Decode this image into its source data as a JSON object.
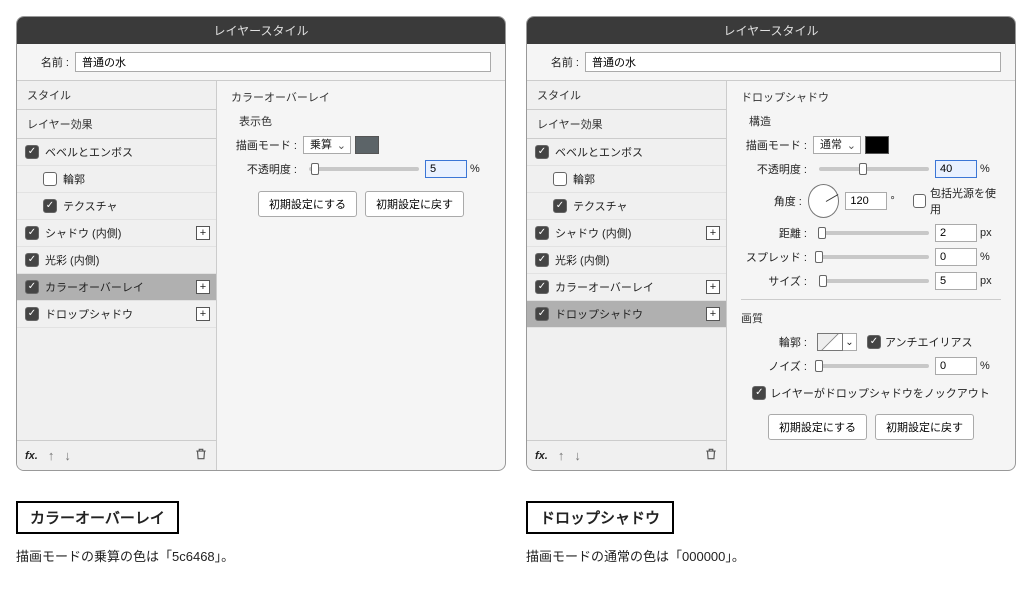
{
  "common": {
    "window_title": "レイヤースタイル",
    "name_label": "名前 :",
    "layer_name": "普通の水",
    "side": {
      "header_style": "スタイル",
      "header_effects": "レイヤー効果",
      "items": [
        {
          "label": "ベベルとエンボス",
          "checked": true,
          "plus": false,
          "child": false
        },
        {
          "label": "輪郭",
          "checked": false,
          "plus": false,
          "child": true
        },
        {
          "label": "テクスチャ",
          "checked": true,
          "plus": false,
          "child": true
        },
        {
          "label": "シャドウ (内側)",
          "checked": true,
          "plus": true,
          "child": false
        },
        {
          "label": "光彩 (内側)",
          "checked": true,
          "plus": false,
          "child": false
        },
        {
          "label": "カラーオーバーレイ",
          "checked": true,
          "plus": true,
          "child": false
        },
        {
          "label": "ドロップシャドウ",
          "checked": true,
          "plus": true,
          "child": false
        }
      ]
    },
    "buttons": {
      "default": "初期設定にする",
      "reset": "初期設定に戻す"
    }
  },
  "left": {
    "selected_index": 5,
    "group_title": "カラーオーバーレイ",
    "section_title": "表示色",
    "blend_label": "描画モード :",
    "blend_value": "乗算",
    "swatch_color": "#5c6468",
    "opacity_label": "不透明度 :",
    "opacity_value": "5",
    "opacity_unit": "%",
    "caption_title": "カラーオーバーレイ",
    "caption_text": "描画モードの乗算の色は「5c6468」。"
  },
  "right": {
    "selected_index": 6,
    "group_title": "ドロップシャドウ",
    "section_structure": "構造",
    "blend_label": "描画モード :",
    "blend_value": "通常",
    "swatch_color": "#000000",
    "opacity_label": "不透明度 :",
    "opacity_value": "40",
    "angle_label": "角度 :",
    "angle_value": "120",
    "angle_unit": "°",
    "global_light_label": "包括光源を使用",
    "distance_label": "距離 :",
    "distance_value": "2",
    "distance_unit": "px",
    "spread_label": "スプレッド :",
    "spread_value": "0",
    "spread_unit": "%",
    "size_label": "サイズ :",
    "size_value": "5",
    "size_unit": "px",
    "section_quality": "画質",
    "contour_label": "輪郭 :",
    "antialias_label": "アンチエイリアス",
    "noise_label": "ノイズ :",
    "noise_value": "0",
    "noise_unit": "%",
    "knockout_label": "レイヤーがドロップシャドウをノックアウト",
    "caption_title": "ドロップシャドウ",
    "caption_text": "描画モードの通常の色は「000000」。"
  }
}
